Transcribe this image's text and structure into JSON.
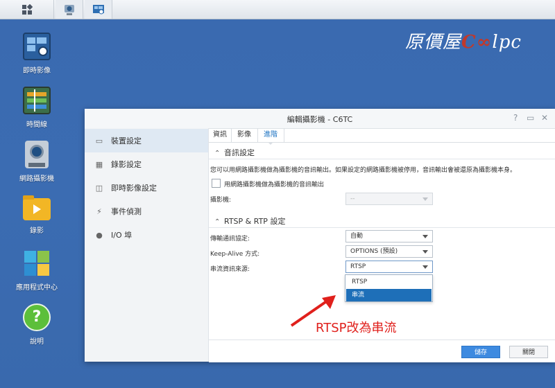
{
  "desktop": {
    "icons": [
      {
        "label": "即時影像",
        "icon": "live-view-icon"
      },
      {
        "label": "時間線",
        "icon": "timeline-icon"
      },
      {
        "label": "網路攝影機",
        "icon": "ip-camera-icon"
      },
      {
        "label": "錄影",
        "icon": "recording-folder-icon"
      },
      {
        "label": "應用程式中心",
        "icon": "app-center-icon"
      },
      {
        "label": "說明",
        "icon": "help-icon"
      }
    ],
    "logo": {
      "text_pre": "原價屋",
      "mark_c": "C",
      "mark_oo": "∞",
      "text_post": "lpc"
    }
  },
  "window": {
    "title": "編輯攝影機 - C6TC",
    "controls": {
      "help": "?",
      "maximize": "▭",
      "close": "✕"
    },
    "sidebar": [
      {
        "label": "裝置設定",
        "icon": "device-settings-icon",
        "glyph": "▭",
        "active": true
      },
      {
        "label": "錄影設定",
        "icon": "calendar-icon",
        "glyph": "▦",
        "active": false
      },
      {
        "label": "即時影像設定",
        "icon": "live-settings-icon",
        "glyph": "◫",
        "active": false
      },
      {
        "label": "事件偵測",
        "icon": "lightning-icon",
        "glyph": "⚡",
        "active": false
      },
      {
        "label": "I/O 埠",
        "icon": "io-port-icon",
        "glyph": "●",
        "active": false
      }
    ],
    "tabs": [
      "資訊",
      "影像",
      "進階"
    ],
    "audio_section": {
      "title": "音訊設定",
      "description": "您可以用網路攝影機做為攝影機的音訊輸出。如果設定的網路攝影機被停用，音訊輸出會被還原為攝影機本身。",
      "checkbox_label": "用網路攝影機做為攝影機的音訊輸出",
      "camera_label": "攝影機:",
      "camera_value": "--"
    },
    "rtsp_section": {
      "title": "RTSP & RTP 設定",
      "protocol_label": "傳輸通訊協定:",
      "protocol_value": "自動",
      "keepalive_label": "Keep-Alive 方式:",
      "keepalive_value": "OPTIONS (預設)",
      "source_label": "串流資訊來源:",
      "source_value": "RTSP",
      "source_options": [
        "RTSP",
        "串流"
      ],
      "source_highlighted": "串流"
    },
    "footer": {
      "save": "儲存",
      "close": "關閉"
    }
  },
  "annotation": {
    "text": "RTSP改為串流",
    "color": "#e0201c"
  }
}
